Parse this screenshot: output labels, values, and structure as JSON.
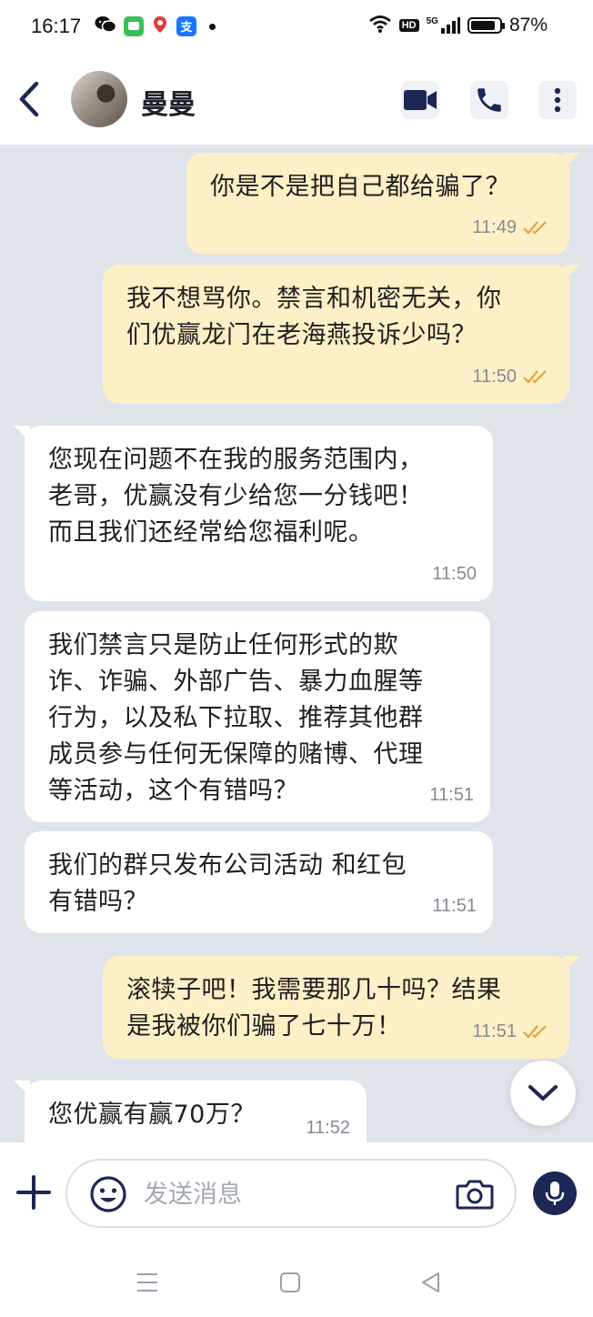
{
  "status_bar": {
    "time": "16:17",
    "network": "5G",
    "hd": "HD",
    "battery_percent": "87%",
    "battery_level": 0.87
  },
  "header": {
    "contact_name": "曼曼"
  },
  "messages": [
    {
      "direction": "out",
      "text": "你是不是把自己都给骗了？",
      "time": "11:49",
      "read": true
    },
    {
      "direction": "out",
      "text": "我不想骂你。禁言和机密无关，你\n们优赢龙门在老海燕投诉少吗？",
      "time": "11:50",
      "read": true
    },
    {
      "direction": "in",
      "text": "您现在问题不在我的服务范围内，\n老哥，优赢没有少给您一分钱吧！\n而且我们还经常给您福利呢。",
      "time": "11:50"
    },
    {
      "direction": "in",
      "text": "我们禁言只是防止任何形式的欺\n诈、诈骗、外部广告、暴力血腥等\n行为，以及私下拉取、推荐其他群\n成员参与任何无保障的赌博、代理\n等活动，这个有错吗？",
      "time": "11:51"
    },
    {
      "direction": "in",
      "text": "我们的群只发布公司活动 和红包\n有错吗？",
      "time": "11:51"
    },
    {
      "direction": "out",
      "text": "滚犊子吧！我需要那几十吗？结果\n是我被你们骗了七十万！",
      "time": "11:51",
      "read": true
    },
    {
      "direction": "in",
      "text": "您优赢有赢70万？",
      "time": "11:52"
    }
  ],
  "composer": {
    "placeholder": "发送消息"
  },
  "colors": {
    "outgoing_bubble": "#fdefc6",
    "incoming_bubble": "#ffffff",
    "chat_background": "#dfe3ea",
    "accent": "#1c2755",
    "read_ticks": "#e3a33b"
  }
}
